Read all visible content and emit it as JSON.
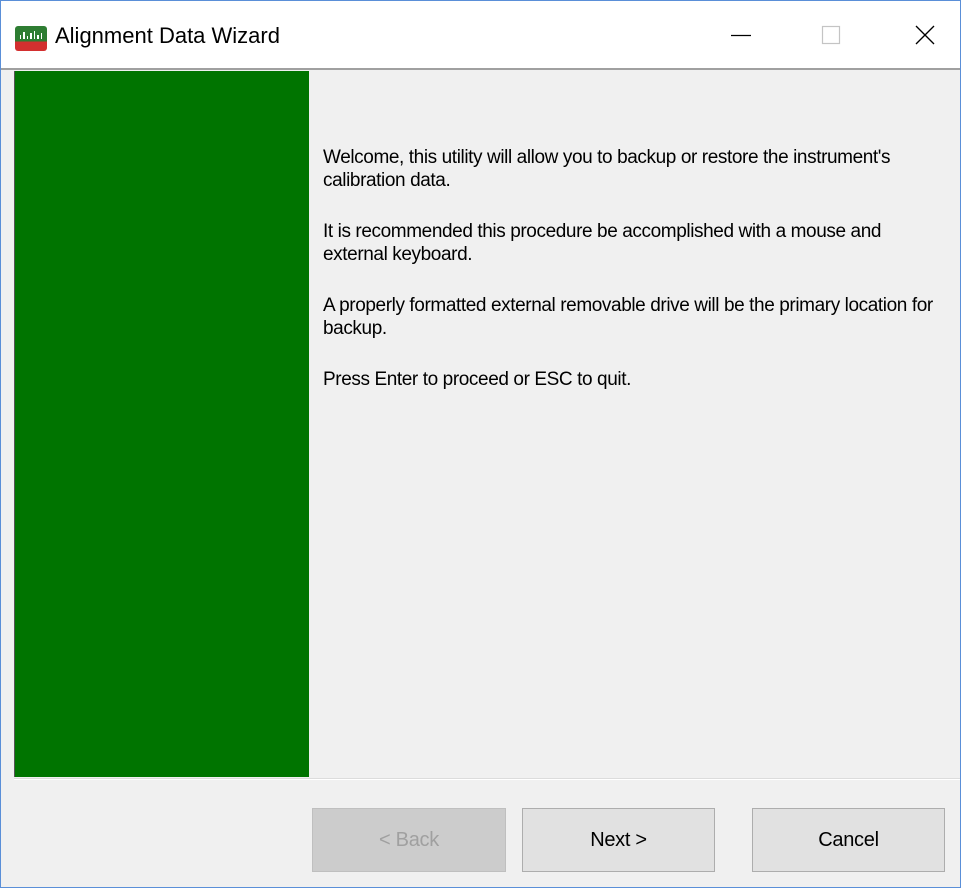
{
  "window": {
    "title": "Alignment Data Wizard",
    "icon": "app-icon"
  },
  "titlebar_buttons": {
    "minimize": "minimize-icon",
    "maximize": "maximize-icon",
    "close": "close-icon"
  },
  "side_panel": {
    "color": "#007400"
  },
  "content": {
    "paragraphs": [
      "Welcome, this utility will allow you to backup or restore the instrument's calibration data.",
      "It is recommended this procedure be accomplished with a mouse and external keyboard.",
      "A properly formatted external removable drive will be the primary location for backup.",
      "Press Enter to proceed or ESC to quit."
    ]
  },
  "buttons": {
    "back": "< Back",
    "next": "Next >",
    "cancel": "Cancel"
  }
}
